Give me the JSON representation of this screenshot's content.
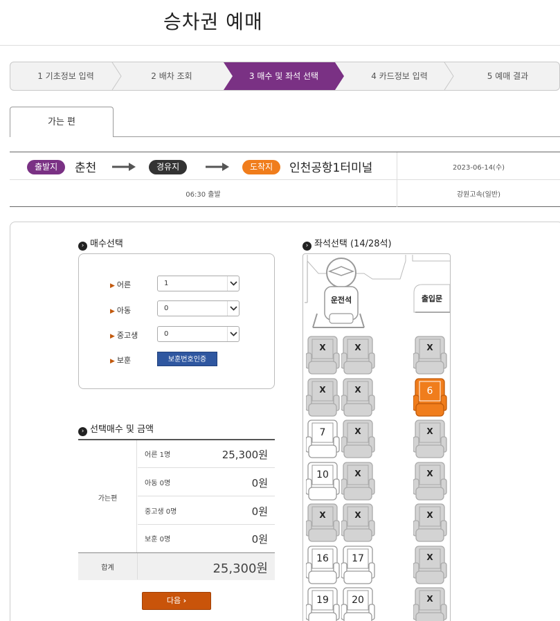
{
  "page_title": "승차권 예매",
  "steps": [
    {
      "label": "1 기초정보 입력",
      "active": false
    },
    {
      "label": "2 배차 조회",
      "active": false
    },
    {
      "label": "3 매수 및 좌석 선택",
      "active": true
    },
    {
      "label": "4 카드정보 입력",
      "active": false
    },
    {
      "label": "5 예매 결과",
      "active": false
    }
  ],
  "tab": {
    "label": "가는 편"
  },
  "route": {
    "departure_badge": "출발지",
    "departure": "춘천",
    "via_badge": "경유지",
    "arrival_badge": "도착지",
    "arrival": "인천공항1터미널",
    "date": "2023-06-14(수)",
    "time": "06:30 출발",
    "company": "강원고속(일반)"
  },
  "count_section": {
    "title": "매수선택",
    "rows": [
      {
        "label": "어른",
        "value": "1"
      },
      {
        "label": "아동",
        "value": "0"
      },
      {
        "label": "중고생",
        "value": "0"
      }
    ],
    "veteran_label": "보훈",
    "veteran_button": "보훈번호인증"
  },
  "price_section": {
    "title": "선택매수 및 금액",
    "direction": "가는편",
    "rows": [
      {
        "label": "어른 1명",
        "value": "25,300원"
      },
      {
        "label": "아동 0명",
        "value": "0원"
      },
      {
        "label": "중고생 0명",
        "value": "0원"
      },
      {
        "label": "보훈 0명",
        "value": "0원"
      }
    ],
    "total_label": "합계",
    "total_value": "25,300원"
  },
  "next_button": "다음",
  "seat_section": {
    "title": "좌석선택 (14/28석)",
    "driver_label": "운전석",
    "door_label": "출입문",
    "seats": [
      {
        "label": "X",
        "state": "taken"
      },
      {
        "label": "X",
        "state": "taken"
      },
      {
        "label": "X",
        "state": "taken"
      },
      {
        "label": "X",
        "state": "taken"
      },
      {
        "label": "X",
        "state": "taken"
      },
      {
        "label": "6",
        "state": "selected"
      },
      {
        "label": "7",
        "state": "available"
      },
      {
        "label": "X",
        "state": "taken"
      },
      {
        "label": "X",
        "state": "taken"
      },
      {
        "label": "10",
        "state": "available"
      },
      {
        "label": "X",
        "state": "taken"
      },
      {
        "label": "X",
        "state": "taken"
      },
      {
        "label": "X",
        "state": "taken"
      },
      {
        "label": "X",
        "state": "taken"
      },
      {
        "label": "X",
        "state": "taken"
      },
      {
        "label": "16",
        "state": "available"
      },
      {
        "label": "17",
        "state": "available"
      },
      {
        "label": "X",
        "state": "taken"
      },
      {
        "label": "19",
        "state": "available"
      },
      {
        "label": "20",
        "state": "available"
      },
      {
        "label": "X",
        "state": "taken"
      }
    ]
  },
  "colors": {
    "purple": "#7a3184",
    "orange": "#f07d1c",
    "dark": "#333333",
    "button_blue": "#2f57a0",
    "button_orange": "#c9540a"
  }
}
